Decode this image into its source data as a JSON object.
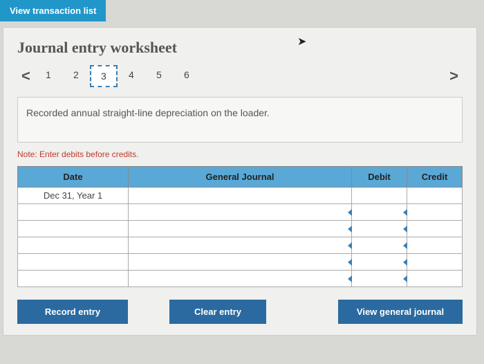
{
  "tab": {
    "label": "View transaction list"
  },
  "title": "Journal entry worksheet",
  "nav": {
    "prev": "<",
    "next": ">",
    "steps": [
      "1",
      "2",
      "3",
      "4",
      "5",
      "6"
    ],
    "active_index": 2
  },
  "description": "Recorded annual straight-line depreciation on the loader.",
  "note": "Note: Enter debits before credits.",
  "table": {
    "headers": {
      "date": "Date",
      "gj": "General Journal",
      "debit": "Debit",
      "credit": "Credit"
    },
    "rows": [
      {
        "date": "Dec 31, Year 1",
        "gj": "",
        "debit": "",
        "credit": ""
      },
      {
        "date": "",
        "gj": "",
        "debit": "",
        "credit": ""
      },
      {
        "date": "",
        "gj": "",
        "debit": "",
        "credit": ""
      },
      {
        "date": "",
        "gj": "",
        "debit": "",
        "credit": ""
      },
      {
        "date": "",
        "gj": "",
        "debit": "",
        "credit": ""
      },
      {
        "date": "",
        "gj": "",
        "debit": "",
        "credit": ""
      }
    ]
  },
  "buttons": {
    "record": "Record entry",
    "clear": "Clear entry",
    "view": "View general journal"
  }
}
